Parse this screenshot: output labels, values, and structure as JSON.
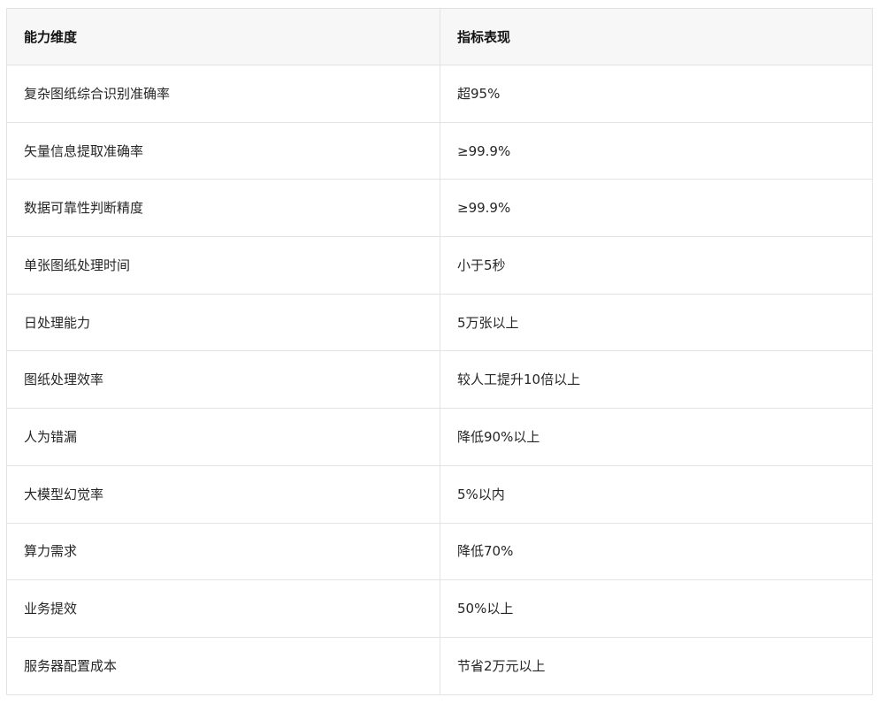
{
  "table": {
    "headers": [
      "能力维度",
      "指标表现"
    ],
    "rows": [
      [
        "复杂图纸综合识别准确率",
        "超95%"
      ],
      [
        "矢量信息提取准确率",
        "≥99.9%"
      ],
      [
        "数据可靠性判断精度",
        "≥99.9%"
      ],
      [
        "单张图纸处理时间",
        "小于5秒"
      ],
      [
        "日处理能力",
        "5万张以上"
      ],
      [
        "图纸处理效率",
        "较人工提升10倍以上"
      ],
      [
        "人为错漏",
        "降低90%以上"
      ],
      [
        "大模型幻觉率",
        "5%以内"
      ],
      [
        "算力需求",
        "降低70%"
      ],
      [
        "业务提效",
        "50%以上"
      ],
      [
        "服务器配置成本",
        "节省2万元以上"
      ]
    ]
  }
}
